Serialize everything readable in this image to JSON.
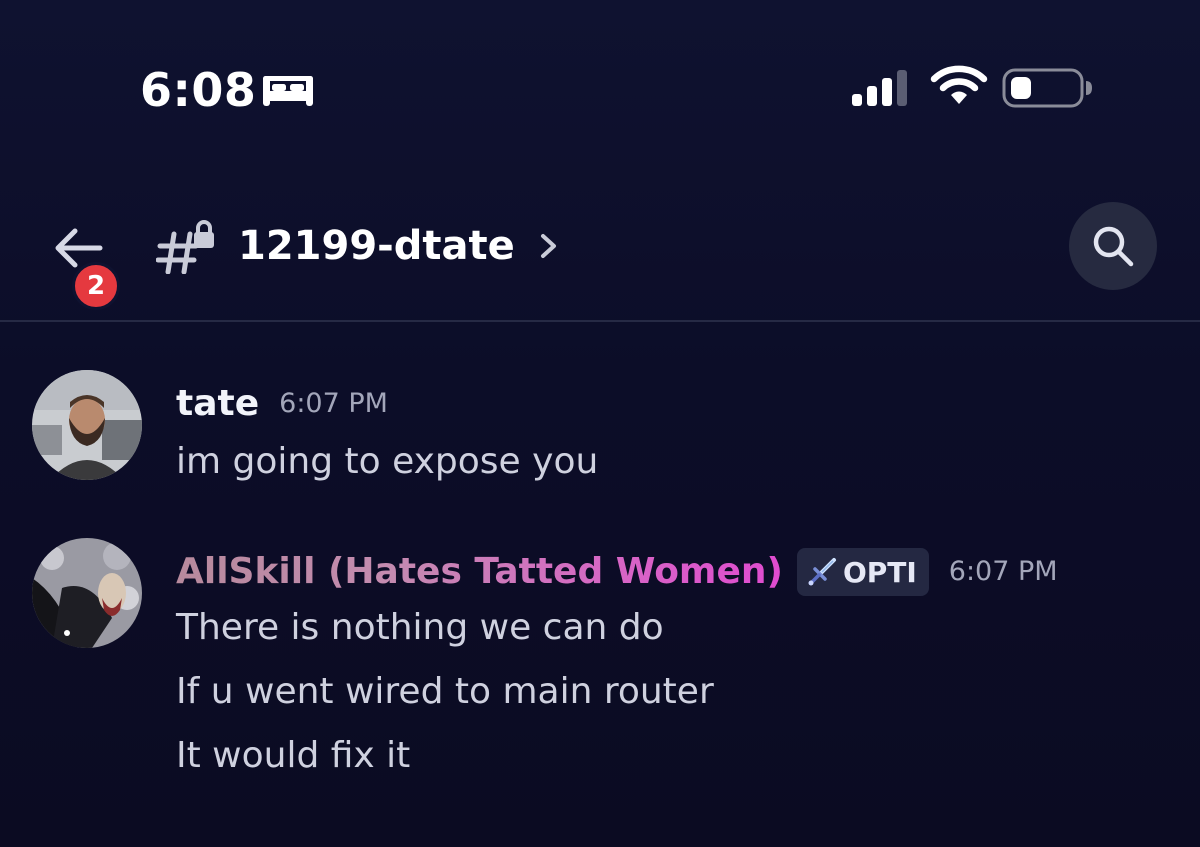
{
  "status_bar": {
    "time": "6:08",
    "sleep_icon": "bed-icon",
    "signal_icon": "cellular-signal-icon",
    "wifi_icon": "wifi-icon",
    "battery_icon": "battery-icon"
  },
  "header": {
    "back_icon": "arrow-left-icon",
    "unread_badge": "2",
    "channel_icon": "hash-lock-icon",
    "channel_name": "12199-dtate",
    "chevron_icon": "chevron-right-icon",
    "search_icon": "search-icon"
  },
  "messages": [
    {
      "author": "tate",
      "timestamp": "6:07 PM",
      "lines": [
        "im going to expose you"
      ]
    },
    {
      "author": "AllSkill (Hates Tatted Women)",
      "role_tag": "OPTI",
      "role_icon": "sword-icon",
      "timestamp": "6:07 PM",
      "lines": [
        "There is nothing we can do",
        "If u went wired to main router",
        "It would fix it"
      ]
    }
  ],
  "colors": {
    "background": "#0c0d26",
    "badge": "#e5393f",
    "username_gradient_start": "#b78a9d",
    "username_gradient_end": "#e04bd0",
    "timestamp": "#a3a6ba"
  }
}
